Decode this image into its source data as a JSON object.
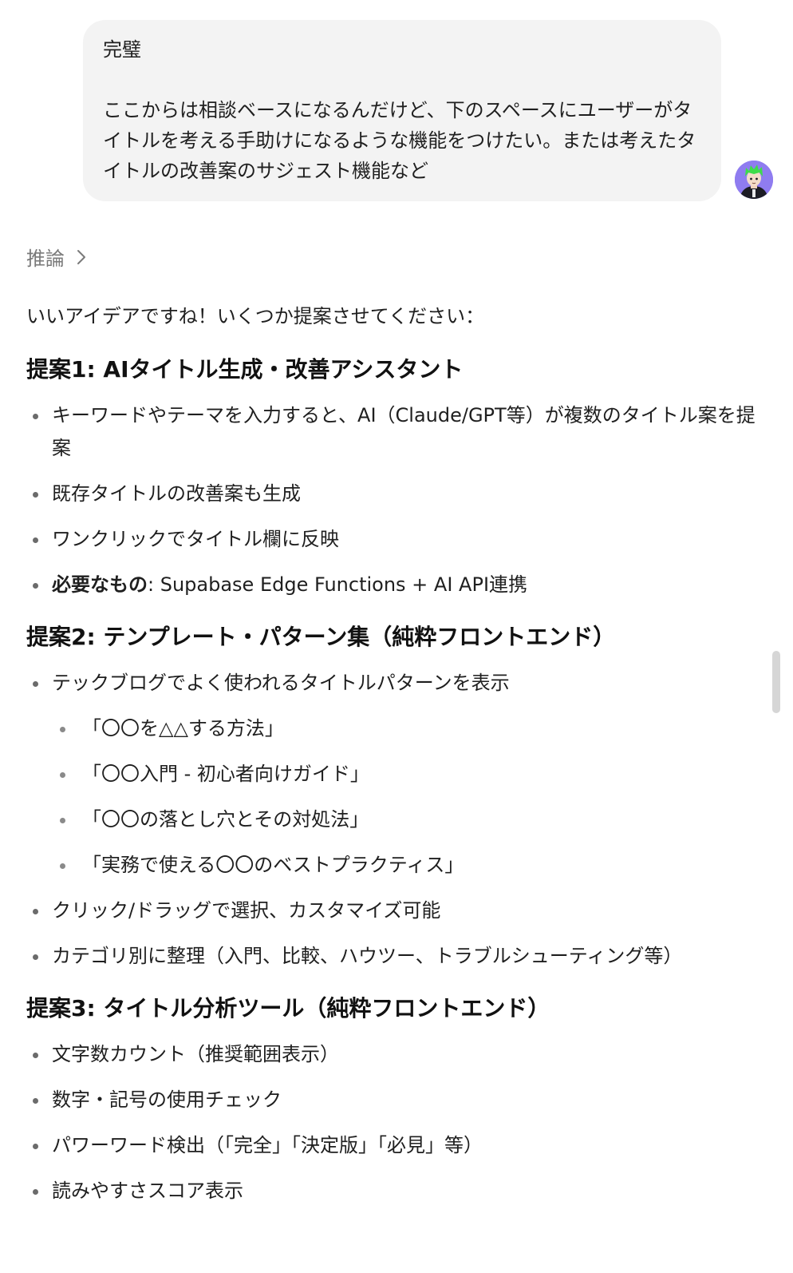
{
  "user_message": {
    "line1": "完璧",
    "paragraph": "ここからは相談ベースになるんだけど、下のスペースにユーザーがタイトルを考える手助けになるような機能をつけたい。または考えたタイトルの改善案のサジェスト機能など"
  },
  "reasoning": {
    "label": "推論",
    "icon": "chevron-right-icon"
  },
  "assistant": {
    "intro": "いいアイデアですね！いくつか提案させてください：",
    "proposal1": {
      "title": "提案1: AIタイトル生成・改善アシスタント",
      "items": [
        "キーワードやテーマを入力すると、AI（Claude/GPT等）が複数のタイトル案を提案",
        "既存タイトルの改善案も生成",
        "ワンクリックでタイトル欄に反映"
      ],
      "requirement_label": "必要なもの",
      "requirement_value": ": Supabase Edge Functions + AI API連携"
    },
    "proposal2": {
      "title": "提案2: テンプレート・パターン集（純粋フロントエンド）",
      "item1": "テックブログでよく使われるタイトルパターンを表示",
      "patterns": [
        "「〇〇を△△する方法」",
        "「〇〇入門 - 初心者向けガイド」",
        "「〇〇の落とし穴とその対処法」",
        "「実務で使える〇〇のベストプラクティス」"
      ],
      "item2": "クリック/ドラッグで選択、カスタマイズ可能",
      "item3": "カテゴリ別に整理（入門、比較、ハウツー、トラブルシューティング等）"
    },
    "proposal3": {
      "title": "提案3: タイトル分析ツール（純粋フロントエンド）",
      "items": [
        "文字数カウント（推奨範囲表示）",
        "数字・記号の使用チェック",
        "パワーワード検出（「完全」「決定版」「必見」等）",
        "読みやすさスコア表示"
      ]
    }
  },
  "colors": {
    "bubble_bg": "#f3f3f3",
    "reasoning_text": "#7a7a7a",
    "avatar_bg": "#8f7cf0",
    "avatar_hair": "#3ddc4a"
  }
}
